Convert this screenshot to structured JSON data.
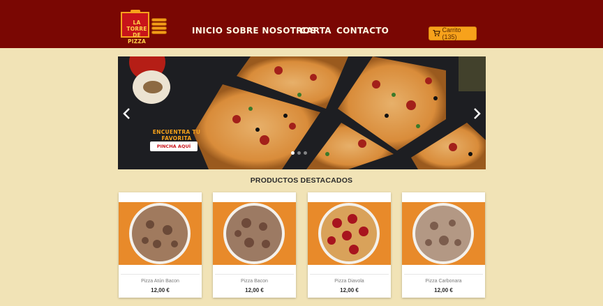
{
  "brand": {
    "logo_text": "LA TORRE DE PIZZA",
    "colors": {
      "header": "#7a0703",
      "accent": "#f7a21b",
      "page_bg": "#f1e3b6",
      "logo_red": "#c8141a"
    }
  },
  "nav": {
    "items": [
      {
        "label": "INICIO"
      },
      {
        "label": "SOBRE NOSOTROS"
      },
      {
        "label": "CARTA"
      },
      {
        "label": "CONTACTO"
      }
    ]
  },
  "cart": {
    "label": "Carrito (135)",
    "icon": "shopping-cart-icon"
  },
  "carousel": {
    "slogan": "ENCUENTRA TU FAVORITA",
    "cta_label": "PINCHA AQUÍ",
    "slide_count": 3,
    "active_slide": 1
  },
  "featured": {
    "title": "PRODUCTOS DESTACADOS",
    "products": [
      {
        "name": "Pizza Atún Bacon",
        "price": "12,00 €"
      },
      {
        "name": "Pizza Bacon",
        "price": "12,00 €"
      },
      {
        "name": "Pizza Diavola",
        "price": "12,00 €"
      },
      {
        "name": "Pizza Carbonara",
        "price": "12,00 €"
      }
    ]
  }
}
